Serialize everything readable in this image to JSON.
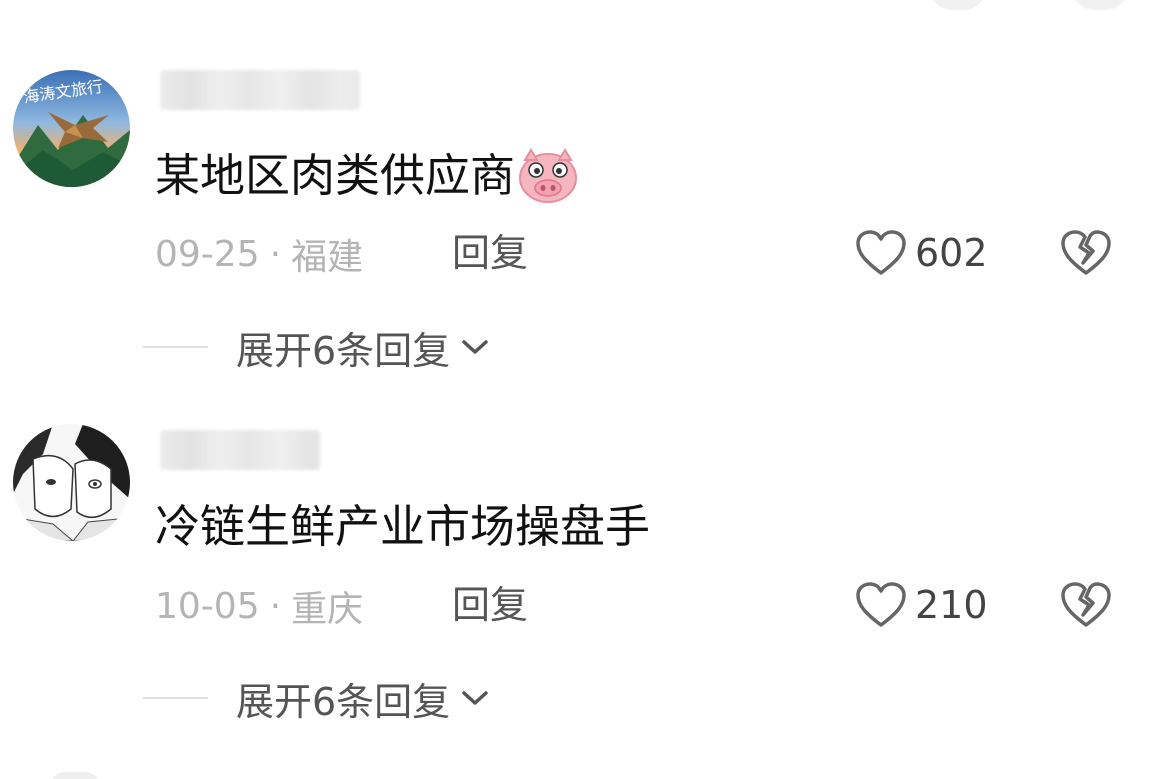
{
  "comments": [
    {
      "text": "某地区肉类供应商",
      "emoji": "pig-face",
      "date": "09-25",
      "separator": "·",
      "location": "福建",
      "reply_label": "回复",
      "likes": "602",
      "expand_label": "展开6条回复"
    },
    {
      "text": "冷链生鲜产业市场操盘手",
      "date": "10-05",
      "separator": "·",
      "location": "重庆",
      "reply_label": "回复",
      "likes": "210",
      "expand_label": "展开6条回复"
    }
  ],
  "icons": {
    "like": "heart-outline-icon",
    "dislike": "broken-heart-icon",
    "expand": "chevron-down-icon"
  },
  "colors": {
    "text_primary": "#111111",
    "text_meta": "#b4b4b4",
    "text_action": "#555555",
    "icon_gray": "#666666"
  }
}
